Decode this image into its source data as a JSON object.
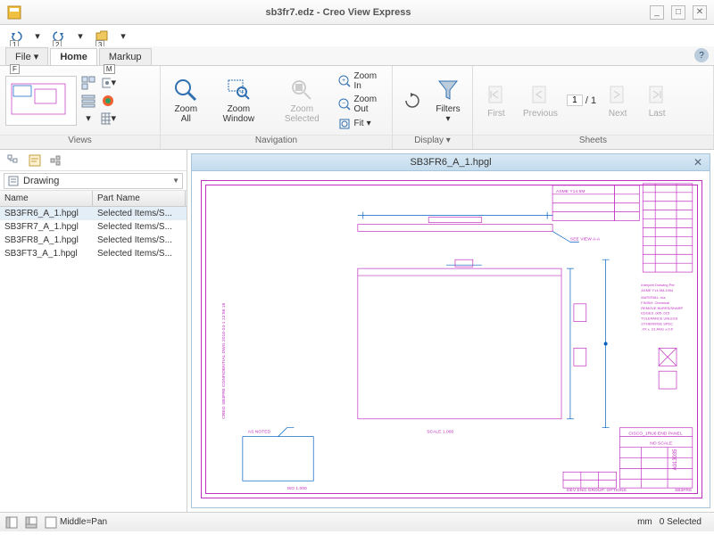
{
  "window": {
    "title": "sb3fr7.edz - Creo View Express"
  },
  "qat_badges": [
    "1",
    "2",
    "3"
  ],
  "tabs": {
    "file": "File",
    "home": "Home",
    "markup": "Markup",
    "file_tip": "F",
    "markup_tip": "M"
  },
  "ribbon": {
    "views_label": "Views",
    "nav_label": "Navigation",
    "display_label": "Display",
    "sheets_label": "Sheets",
    "zoom_all": "Zoom\nAll",
    "zoom_window": "Zoom\nWindow",
    "zoom_selected": "Zoom\nSelected",
    "zoom_in": "Zoom In",
    "zoom_out": "Zoom Out",
    "fit": "Fit",
    "filters": "Filters",
    "first": "First",
    "previous": "Previous",
    "next": "Next",
    "last": "Last",
    "sheet_current": "1",
    "sheet_total": "/ 1"
  },
  "sidebar": {
    "combo_label": "Drawing",
    "col_name": "Name",
    "col_part": "Part Name",
    "rows": [
      {
        "name": "SB3FR6_A_1.hpgl",
        "part": "Selected Items/S..."
      },
      {
        "name": "SB3FR7_A_1.hpgl",
        "part": "Selected Items/S..."
      },
      {
        "name": "SB3FR8_A_1.hpgl",
        "part": "Selected Items/S..."
      },
      {
        "name": "SB3FT3_A_1.hpgl",
        "part": "Selected Items/S..."
      }
    ],
    "selected": 0
  },
  "viewer": {
    "title": "SB3FR6_A_1.hpgl"
  },
  "status": {
    "mode": "Middle=Pan",
    "units": "mm",
    "selection": "0 Selected"
  }
}
